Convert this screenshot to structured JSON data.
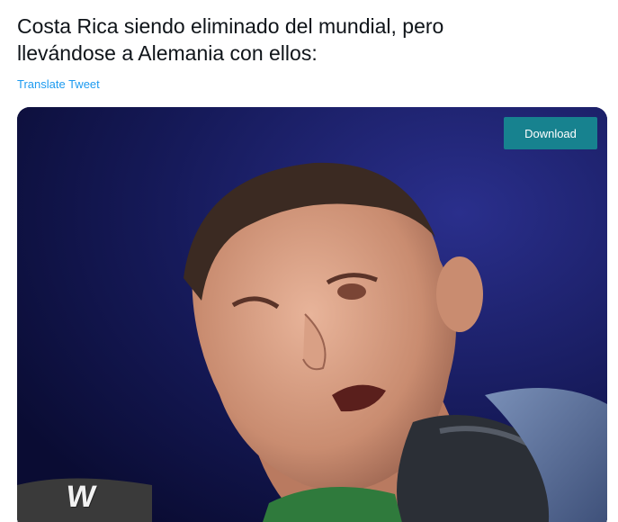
{
  "tweet": {
    "text_line1": "Costa Rica siendo eliminado del mundial, pero",
    "text_line2": "llevándose a Alemania con ellos:",
    "translate_label": "Translate Tweet"
  },
  "media": {
    "download_label": "Download",
    "logo_text": "W"
  },
  "colors": {
    "link": "#1d9bf0",
    "download_bg": "#17828f",
    "text": "#0f1419"
  }
}
